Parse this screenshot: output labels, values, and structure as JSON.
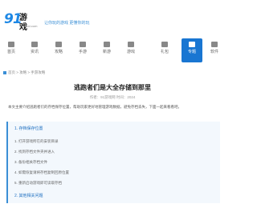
{
  "logo": {
    "number": "91",
    "name": "游戏",
    "sub": "91youxi.com"
  },
  "header": {
    "slogan": "让你玩的游戏 更懂你的玩"
  },
  "nav": [
    {
      "label": "首页",
      "icon": "home-icon"
    },
    {
      "label": "资讯",
      "icon": "news-icon"
    },
    {
      "label": "攻略",
      "icon": "guide-icon"
    },
    {
      "label": "手游",
      "icon": "mobile-game-icon"
    },
    {
      "label": "新游",
      "icon": "new-game-icon"
    },
    {
      "label": "游戏",
      "icon": "game-icon"
    },
    {
      "label": "礼包",
      "icon": "gift-icon"
    },
    {
      "label": "专题",
      "icon": "topic-icon"
    },
    {
      "label": "软件",
      "icon": "software-icon"
    }
  ],
  "breadcrumb": "首页 > 攻略 > 手游攻略",
  "article": {
    "title": "逃跑者们是大全存储到那里",
    "meta": "作者：91游戏网  时间：2024",
    "intro": "本文主要介绍逃跑者们的存档保存位置，帮助玩家更好地管理游戏数据，避免存档丢失，下面一起来看看吧。"
  },
  "toc": {
    "heading": "1. 存档保存位置",
    "lines": [
      "1. 打开游戏所在的安装目录",
      "2. 找到存档文件夹并进入",
      "3. 备份相关存档文件",
      "4. 如需恢复请将存档复制回原位置",
      "5. 重新启动游戏即可读取存档",
      "6. 注意不要随意删除存档文件"
    ]
  },
  "section2": {
    "heading": "2. 其他相关问题"
  }
}
